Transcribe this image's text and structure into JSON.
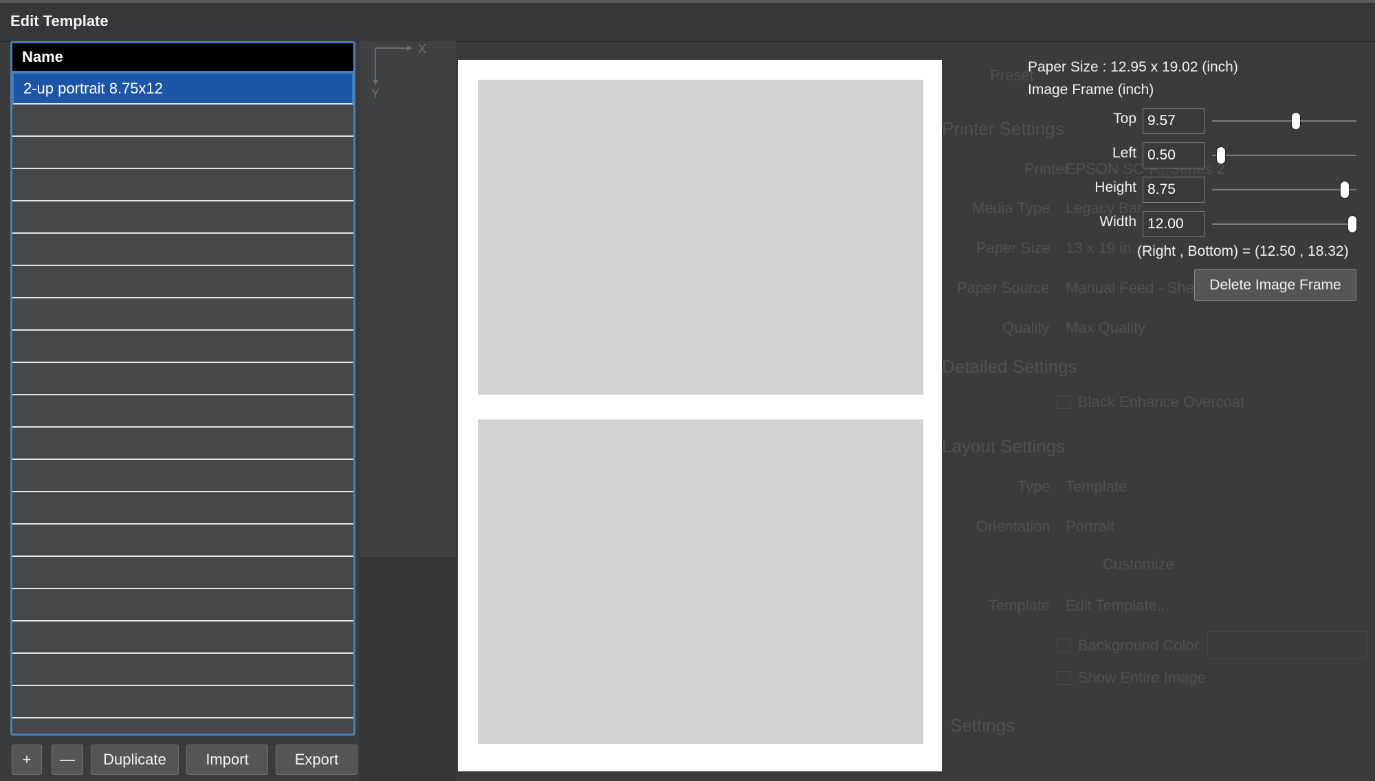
{
  "window": {
    "title": "Edit Template"
  },
  "background": {
    "labels": [
      "Printer",
      "Media Type",
      "Paper Size",
      "Paper Source",
      "Quality",
      "Type",
      "Orientation",
      "Template"
    ],
    "values": [
      "EPSON SC-P...Series 2",
      "Legacy Bar...",
      "13 x 19 in...",
      "Manual Feed - She...",
      "Max Quality",
      "Template",
      "Portrait",
      "Edit Template..."
    ],
    "headings": [
      "Printer Settings",
      "Detailed Settings",
      "Layout Settings",
      "Settings"
    ],
    "checks": [
      "Black Enhance Overcoat",
      "Background Color",
      "Show Entire Image"
    ],
    "misc": [
      "Preset",
      "Customize"
    ]
  },
  "template_list": {
    "header": "Name",
    "items": [
      "2-up portrait 8.75x12"
    ],
    "empty_rows": 19
  },
  "buttons": {
    "add": "+",
    "remove": "—",
    "duplicate": "Duplicate",
    "import": "Import",
    "export": "Export"
  },
  "axis": {
    "x": "X",
    "y": "Y"
  },
  "panel": {
    "paper_size": "Paper Size : 12.95 x 19.02 (inch)",
    "frame_heading": "Image Frame (inch)",
    "fields": [
      {
        "label": "Top",
        "value": "9.57",
        "slider": 0.58
      },
      {
        "label": "Left",
        "value": "0.50",
        "slider": 0.06
      },
      {
        "label": "Height",
        "value": "8.75",
        "slider": 0.92
      },
      {
        "label": "Width",
        "value": "12.00",
        "slider": 0.97
      }
    ],
    "right_bottom": "(Right , Bottom) = (12.50 , 18.32)",
    "delete_label": "Delete Image Frame"
  },
  "colors": {
    "selection": "#1c55a6",
    "list_border": "#4d7fb8",
    "frame": "#d2d2d2"
  }
}
